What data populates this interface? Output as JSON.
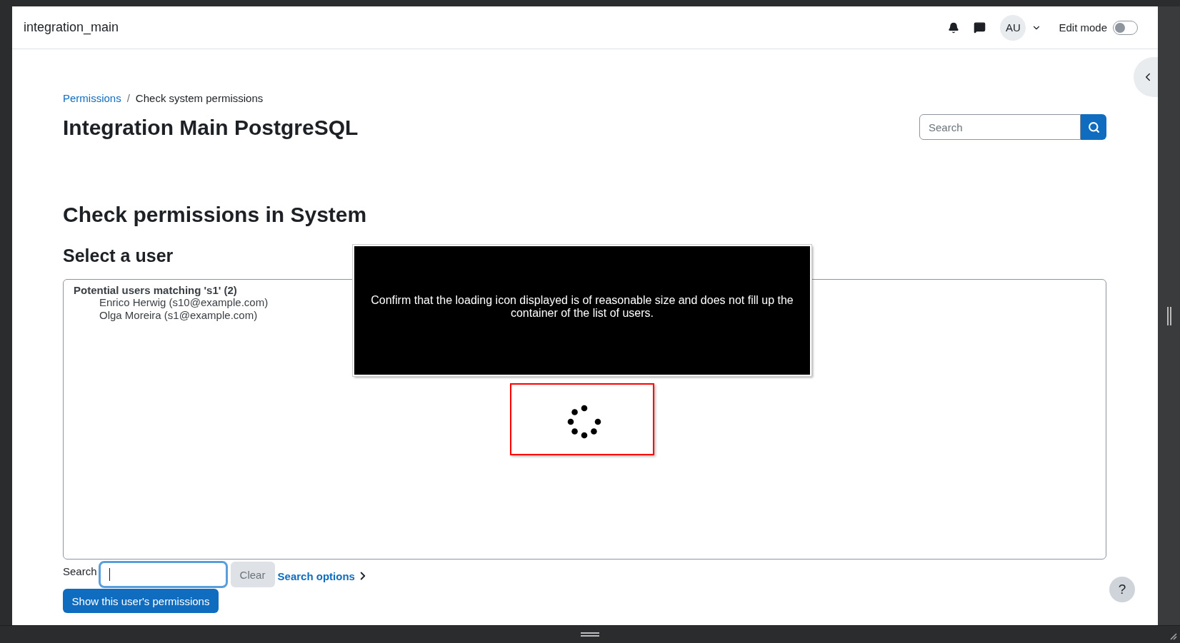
{
  "navbar": {
    "site_name": "integration_main",
    "avatar_initials": "AU",
    "edit_mode": {
      "label": "Edit mode",
      "on": false
    }
  },
  "breadcrumb": {
    "separator": "/",
    "items": [
      {
        "label": "Permissions",
        "link": true
      },
      {
        "label": "Check system permissions",
        "link": false
      }
    ]
  },
  "page_title": "Integration Main PostgreSQL",
  "page_search": {
    "placeholder": "Search"
  },
  "heading": "Check permissions in System",
  "subheading": "Select a user",
  "user_list": {
    "group_label": "Potential users matching 's1' (2)",
    "users": [
      "Enrico Herwig (s10@example.com)",
      "Olga Moreira (s1@example.com)"
    ]
  },
  "search": {
    "label": "Search",
    "focused": true,
    "clear": "Clear",
    "options_link": "Search options"
  },
  "submit": "Show this user's permissions",
  "help": "?",
  "annotation": {
    "text": "Confirm that the loading icon displayed is of reasonable size and does not fill up the container of the list of users."
  }
}
